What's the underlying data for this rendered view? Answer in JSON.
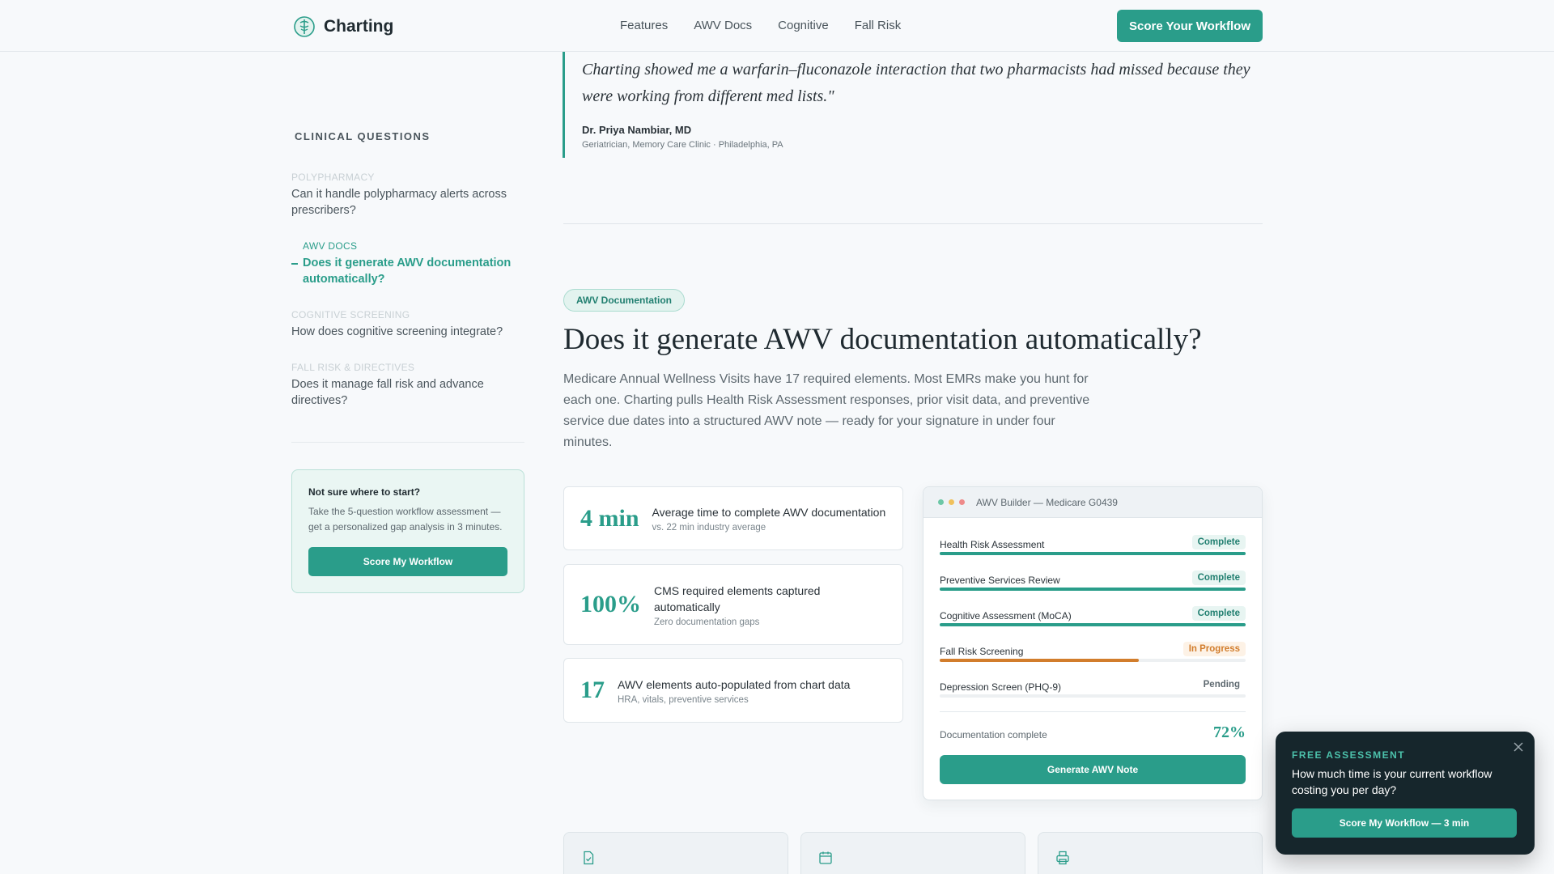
{
  "header": {
    "brand": "Charting",
    "nav": [
      "Features",
      "AWV Docs",
      "Cognitive",
      "Fall Risk"
    ],
    "cta": "Score Your Workflow"
  },
  "quote": {
    "text": "Charting showed me a warfarin–fluconazole interaction that two pharmacists had missed because they were working from different med lists.\"",
    "author": "Dr. Priya Nambiar, MD",
    "role": "Geriatrician, Memory Care Clinic · Philadelphia, PA"
  },
  "sidebar": {
    "title": "CLINICAL QUESTIONS",
    "items": [
      {
        "category": "POLYPHARMACY",
        "question": "Can it handle polypharmacy alerts across prescribers?"
      },
      {
        "category": "AWV DOCS",
        "question": "Does it generate AWV documentation automatically?"
      },
      {
        "category": "COGNITIVE SCREENING",
        "question": "How does cognitive screening integrate?"
      },
      {
        "category": "FALL RISK & DIRECTIVES",
        "question": "Does it manage fall risk and advance directives?"
      }
    ],
    "card": {
      "title": "Not sure where to start?",
      "desc": "Take the 5-question workflow assessment — get a personalized gap analysis in 3 minutes.",
      "button": "Score My Workflow"
    }
  },
  "section": {
    "pill": "AWV Documentation",
    "title": "Does it generate AWV documentation automatically?",
    "desc": "Medicare Annual Wellness Visits have 17 required elements. Most EMRs make you hunt for each one. Charting pulls Health Risk Assessment responses, prior visit data, and preventive service due dates into a structured AWV note — ready for your signature in under four minutes."
  },
  "stats": [
    {
      "num": "4 min",
      "label": "Average time to complete AWV documentation",
      "sub": "vs. 22 min industry average"
    },
    {
      "num": "100%",
      "label": "CMS required elements captured automatically",
      "sub": "Zero documentation gaps"
    },
    {
      "num": "17",
      "label": "AWV elements auto-populated from chart data",
      "sub": "HRA, vitals, preventive services"
    }
  ],
  "panel": {
    "title": "AWV Builder — Medicare G0439",
    "dot_colors": [
      "#6cc7a6",
      "#f0c15c",
      "#ee8a8a"
    ],
    "rows": [
      {
        "name": "Health Risk Assessment",
        "status": "Complete",
        "progress": 1.0,
        "color": "#2a9d8a"
      },
      {
        "name": "Preventive Services Review",
        "status": "Complete",
        "progress": 1.0,
        "color": "#2a9d8a"
      },
      {
        "name": "Cognitive Assessment (MoCA)",
        "status": "Complete",
        "progress": 1.0,
        "color": "#2a9d8a"
      },
      {
        "name": "Fall Risk Screening",
        "status": "In Progress",
        "progress": 0.65,
        "color": "#d27d2c"
      },
      {
        "name": "Depression Screen (PHQ-9)",
        "status": "Pending",
        "progress": 0,
        "color": "#2a9d8a"
      }
    ],
    "doc_label": "Documentation complete",
    "doc_pct": "72%",
    "button": "Generate AWV Note"
  },
  "feature_icons": [
    "document-check-icon",
    "calendar-icon",
    "printer-icon"
  ],
  "popup": {
    "label": "FREE ASSESSMENT",
    "question": "How much time is your current workflow costing you per day?",
    "button": "Score My Workflow — 3 min"
  },
  "colors": {
    "accent": "#2a9d8a",
    "warning": "#d27d2c",
    "popup_bg": "#16262c"
  }
}
